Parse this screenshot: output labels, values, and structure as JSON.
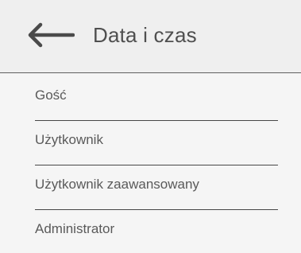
{
  "header": {
    "back_icon": "arrow-left-icon",
    "title": "Data i czas"
  },
  "list": {
    "items": [
      {
        "label": "Gość"
      },
      {
        "label": "Użytkownik"
      },
      {
        "label": "Użytkownik zaawansowany"
      },
      {
        "label": "Administrator"
      }
    ]
  },
  "colors": {
    "background": "#f2f2f2",
    "text": "#555555",
    "divider": "#474747"
  }
}
